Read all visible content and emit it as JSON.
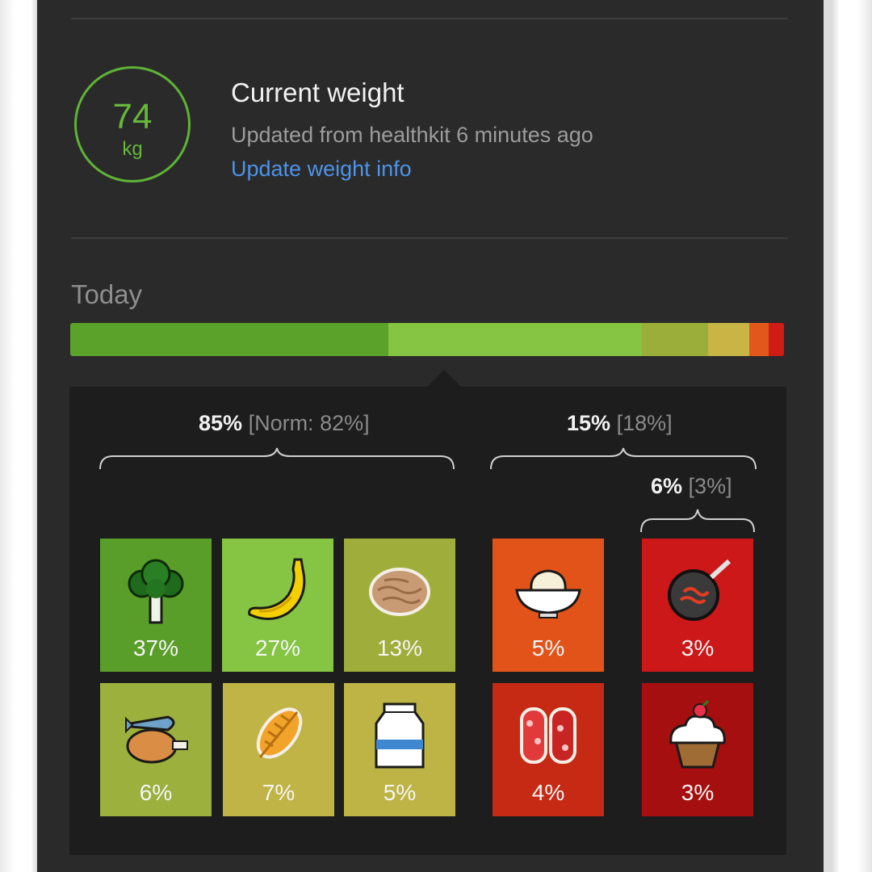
{
  "weight": {
    "value": "74",
    "unit": "kg",
    "title": "Current weight",
    "updated": "Updated from healthkit 6 minutes ago",
    "update_link": "Update weight info"
  },
  "today": {
    "label": "Today",
    "bar_segments": [
      {
        "color": "#5aa22a",
        "share": 0.446
      },
      {
        "color": "#86c443",
        "share": 0.355
      },
      {
        "color": "#9cae3a",
        "share": 0.093
      },
      {
        "color": "#c8b545",
        "share": 0.057
      },
      {
        "color": "#e2581b",
        "share": 0.027
      },
      {
        "color": "#d01c15",
        "share": 0.022
      }
    ]
  },
  "breakdown": {
    "healthy": {
      "pct": "85%",
      "norm": "[Norm: 82%]"
    },
    "unhealthy": {
      "pct": "15%",
      "norm": "[18%]"
    },
    "very_unhealthy": {
      "pct": "6%",
      "norm": "[3%]"
    },
    "tiles": [
      {
        "icon": "broccoli-icon",
        "pct": "37%",
        "color": "#5a9e2a"
      },
      {
        "icon": "banana-icon",
        "pct": "27%",
        "color": "#86c443"
      },
      {
        "icon": "walnut-icon",
        "pct": "13%",
        "color": "#9fae3b"
      },
      {
        "icon": "fish-chicken-icon",
        "pct": "6%",
        "color": "#9cb03e"
      },
      {
        "icon": "grain-icon",
        "pct": "7%",
        "color": "#bfb445"
      },
      {
        "icon": "milk-carton-icon",
        "pct": "5%",
        "color": "#bdb445"
      },
      {
        "icon": "pasta-bowl-icon",
        "pct": "5%",
        "color": "#e2531a"
      },
      {
        "icon": "frying-pan-icon",
        "pct": "3%",
        "color": "#cc1818"
      },
      {
        "icon": "salami-icon",
        "pct": "4%",
        "color": "#c62a15"
      },
      {
        "icon": "cupcake-icon",
        "pct": "3%",
        "color": "#a50f0f"
      }
    ]
  }
}
